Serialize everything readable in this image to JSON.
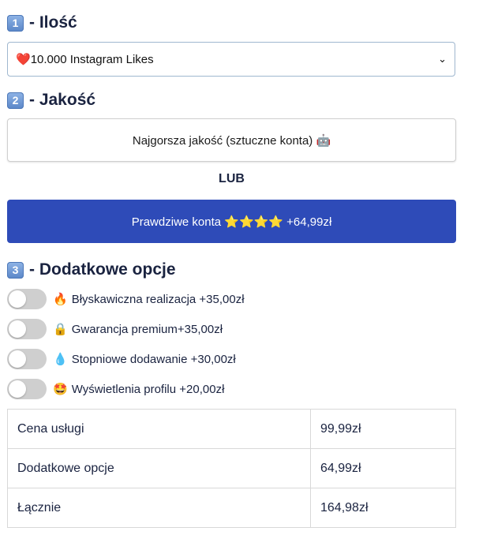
{
  "quantity": {
    "step": "1",
    "title": "- Ilość",
    "selected_icon": "❤️",
    "selected": "10.000 Instagram Likes",
    "chevron": "⌄"
  },
  "quality": {
    "step": "2",
    "title": "- Jakość",
    "option_low": "Najgorsza jakość (sztuczne konta) 🤖",
    "or_label": "LUB",
    "option_high": "Prawdziwe konta ⭐⭐⭐⭐ +64,99zł"
  },
  "extras": {
    "step": "3",
    "title": "- Dodatkowe opcje",
    "options": [
      {
        "icon": "🔥",
        "label": "Błyskawiczna realizacja +35,00zł"
      },
      {
        "icon": "🔒",
        "label": "Gwarancja premium+35,00zł"
      },
      {
        "icon": "💧",
        "label": "Stopniowe dodawanie +30,00zł"
      },
      {
        "icon": "🤩",
        "label": "Wyświetlenia profilu +20,00zł"
      }
    ]
  },
  "summary": {
    "rows": [
      {
        "label": "Cena usługi",
        "value": "99,99zł"
      },
      {
        "label": "Dodatkowe opcje",
        "value": "64,99zł"
      },
      {
        "label": "Łącznie",
        "value": "164,98zł"
      }
    ]
  },
  "colors": {
    "accent_blue": "#2e4bb8",
    "text_dark": "#1a2340",
    "toggle_off": "#cfcfcf"
  }
}
